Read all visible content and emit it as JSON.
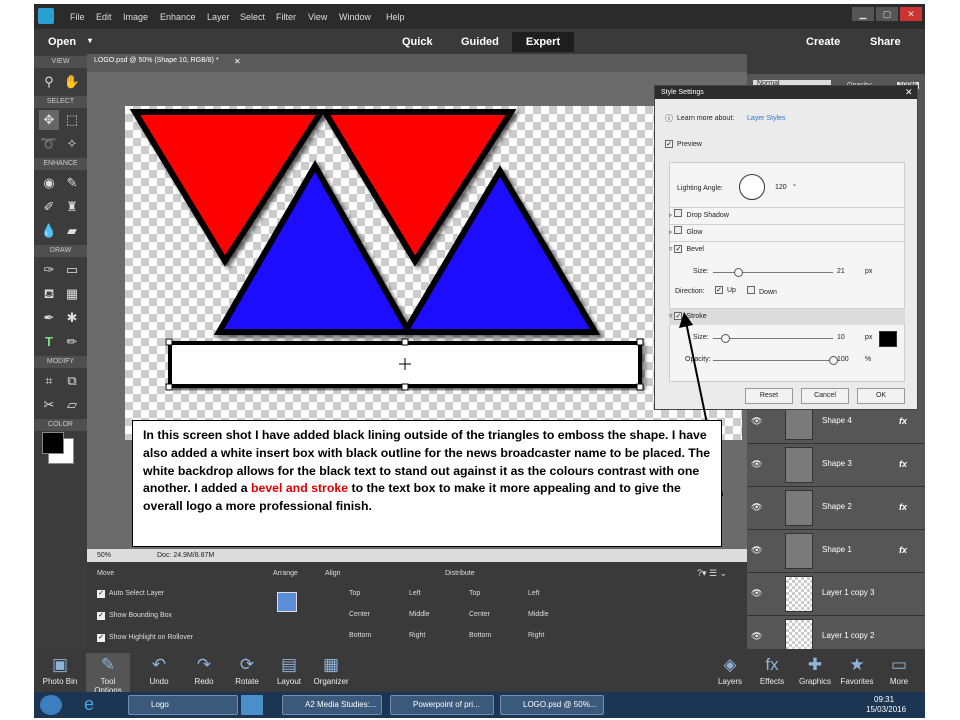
{
  "menubar": {
    "items": [
      "File",
      "Edit",
      "Image",
      "Enhance",
      "Layer",
      "Select",
      "Filter",
      "View",
      "Window",
      "Help"
    ]
  },
  "modebar": {
    "open": "Open",
    "quick": "Quick",
    "guided": "Guided",
    "expert": "Expert",
    "create": "Create",
    "share": "Share"
  },
  "toolbox": {
    "sections": [
      "VIEW",
      "SELECT",
      "ENHANCE",
      "DRAW",
      "MODIFY",
      "COLOR"
    ]
  },
  "document": {
    "tab": "LOGO.psd @ 50% (Shape 10, RGB/8) *",
    "zoom": "50%",
    "doc_size": "Doc: 24.9M/8.87M"
  },
  "options": {
    "move": "Move",
    "arrange": "Arrange",
    "align": "Align",
    "distribute": "Distribute",
    "checks": [
      "Auto Select Layer",
      "Show Bounding Box",
      "Show Highlight on Rollover"
    ],
    "align_items": [
      "Top",
      "Left",
      "Center",
      "Middle",
      "Bottom",
      "Right"
    ],
    "distribute_items": [
      "Top",
      "Left",
      "Center",
      "Middle",
      "Bottom",
      "Right"
    ]
  },
  "layers_panel": {
    "blend": "Normal",
    "opacity_label": "Opacity:",
    "opacity": "100%",
    "layers": [
      {
        "name": "Shape 4",
        "fx": "fx"
      },
      {
        "name": "Shape 3",
        "fx": "fx"
      },
      {
        "name": "Shape 2",
        "fx": "fx"
      },
      {
        "name": "Shape 1",
        "fx": "fx"
      },
      {
        "name": "Layer 1 copy 3"
      },
      {
        "name": "Layer 1 copy 2"
      }
    ]
  },
  "style_settings": {
    "title": "Style Settings",
    "learn": "Learn more about:",
    "learn_link": "Layer Styles",
    "preview": "Preview",
    "lighting_angle": "Lighting Angle:",
    "angle": "120",
    "angle_unit": "°",
    "drop_shadow": "Drop Shadow",
    "glow": "Glow",
    "bevel": "Bevel",
    "size_label": "Size:",
    "bevel_size": "21",
    "bevel_size_value": 0.21,
    "px": "px",
    "direction": "Direction:",
    "up": "Up",
    "down": "Down",
    "stroke": "Stroke",
    "stroke_size": "10",
    "stroke_size_value": 0.1,
    "opacity_label": "Opacity:",
    "stroke_opacity": "100",
    "stroke_opacity_value": 1.0,
    "pct": "%",
    "stroke_color": "#000000",
    "reset": "Reset",
    "cancel": "Cancel",
    "ok": "OK"
  },
  "bottom_bin": {
    "left": [
      "Photo Bin",
      "Tool Options",
      "Undo",
      "Redo",
      "Rotate",
      "Layout",
      "Organizer"
    ],
    "right": [
      "Layers",
      "Effects",
      "Graphics",
      "Favorites",
      "More"
    ]
  },
  "taskbar": {
    "tasks": [
      "Logo",
      "A2 Media Studies:...",
      "Powerpoint of pri...",
      "LOGO.psd @ 50%..."
    ],
    "time": "09:31",
    "date": "15/03/2016"
  },
  "annotation": {
    "text1": "In this screen shot I have added black lining outside of the triangles to emboss the shape. I have also added a white insert box with black outline for the news broadcaster name to be placed. The white backdrop allows for the black text to stand out against it as the colours contrast with one another. I added a",
    "highlight": "bevel and stroke",
    "text2": "to the text box to make it more appealing and to give the overall logo a more professional finish."
  },
  "colors": {
    "triangle_red": "#ff0000",
    "triangle_blue": "#1a10ff",
    "accent": "#29a0d0",
    "highlight": "#e00000"
  }
}
